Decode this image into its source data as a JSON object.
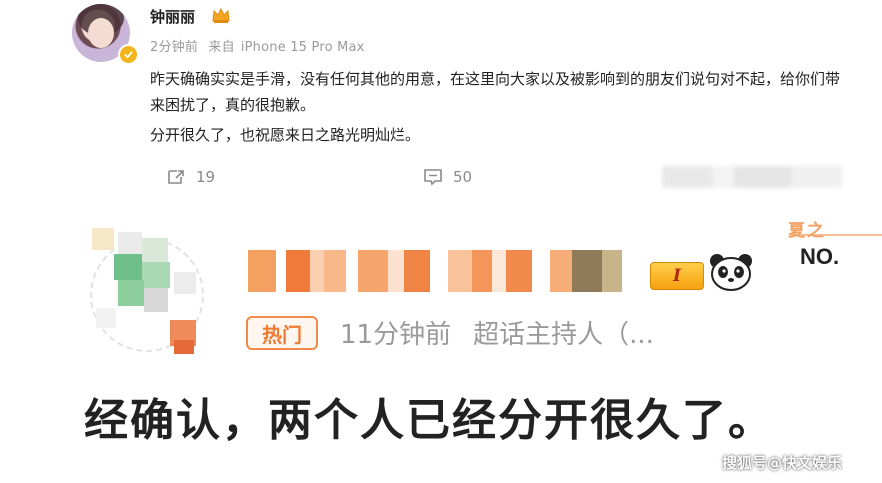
{
  "post": {
    "username": "钟丽丽",
    "time": "2分钟前",
    "source_prefix": "来自",
    "source": "iPhone 15 Pro Max",
    "paragraph_1": "昨天确确实实是手滑，没有任何其他的用意，在这里向大家以及被影响到的朋友们说句对不起，给你们带来困扰了，真的很抱歉。",
    "paragraph_2": "分开很久了，也祝愿来日之路光明灿烂。",
    "repost_count": "19",
    "comment_count": "50"
  },
  "quoted": {
    "rank_badge": "I",
    "promo_top": "夏之",
    "promo_no": "NO.",
    "hot_tag": "热门",
    "time": "11分钟前",
    "source": "超话主持人（...",
    "big_text": "经确认，两个人已经分开很久了。"
  },
  "watermark": "搜狐号@快文娱乐",
  "colors": {
    "accent_orange": "#ef7b33",
    "vip_gold": "#f2b51b",
    "meta_gray": "#9a9a9a"
  },
  "icons": [
    "crown-icon",
    "verified-icon",
    "repost-icon",
    "comment-icon",
    "panda-icon"
  ]
}
